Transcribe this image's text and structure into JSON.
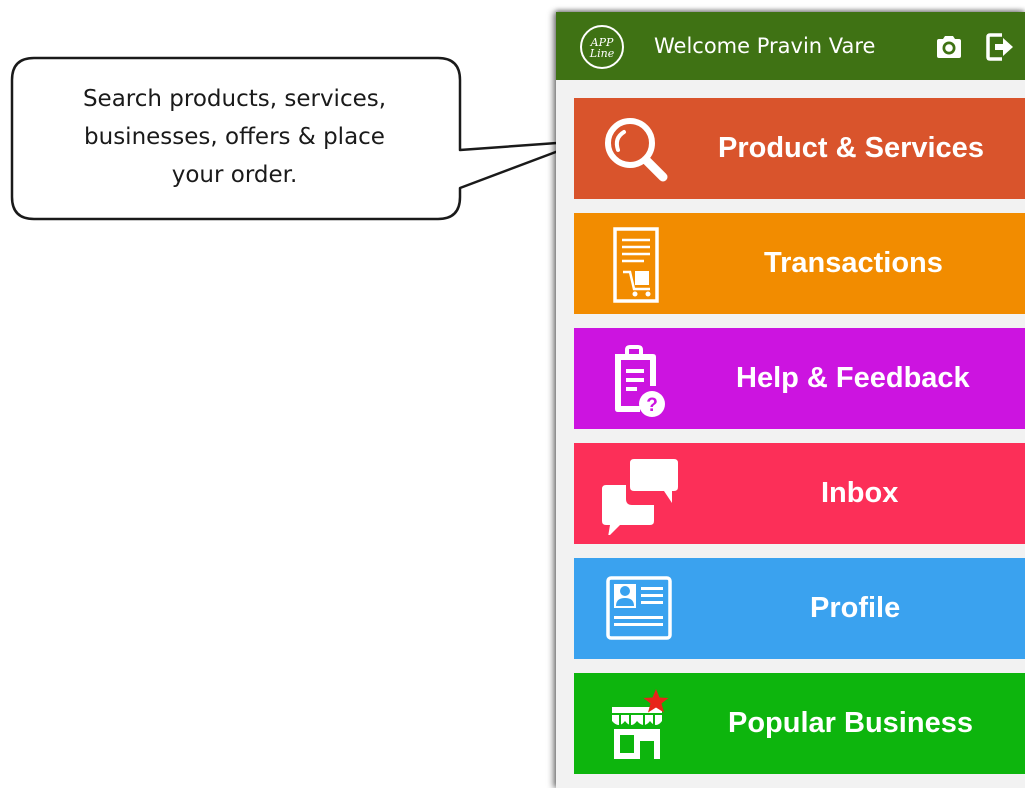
{
  "callout": {
    "line1": "Search products, services,",
    "line2": "businesses, offers & place",
    "line3": "your order."
  },
  "header": {
    "logo_line1": "APP",
    "logo_line2": "Line",
    "welcome": "Welcome Pravin Vare",
    "camera_icon": "camera-icon",
    "logout_icon": "logout-icon",
    "bg_color": "#3f7214"
  },
  "menu": [
    {
      "label": "Product & Services",
      "icon": "search-icon",
      "color": "#d9542c"
    },
    {
      "label": "Transactions",
      "icon": "document-cart-icon",
      "color": "#f28c00"
    },
    {
      "label": "Help & Feedback",
      "icon": "clipboard-help-icon",
      "color": "#cc14e0"
    },
    {
      "label": "Inbox",
      "icon": "chat-bubbles-icon",
      "color": "#fc2f58"
    },
    {
      "label": "Profile",
      "icon": "id-card-icon",
      "color": "#3aa2ef"
    },
    {
      "label": "Popular Business",
      "icon": "storefront-star-icon",
      "color": "#0db50d"
    }
  ]
}
